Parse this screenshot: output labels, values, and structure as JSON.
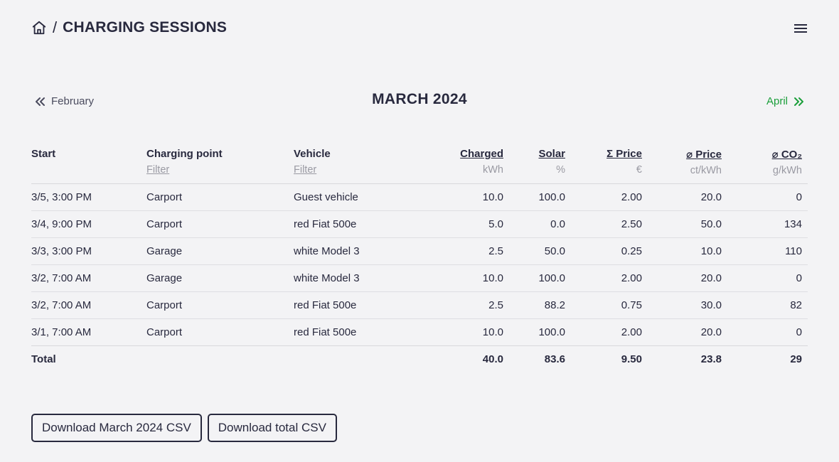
{
  "header": {
    "separator": "/",
    "title": "CHARGING SESSIONS"
  },
  "month_nav": {
    "prev_label": "February",
    "current_label": "MARCH 2024",
    "next_label": "April"
  },
  "table": {
    "headers": {
      "start": "Start",
      "charging_point": "Charging point",
      "charging_point_filter": "Filter",
      "vehicle": "Vehicle",
      "vehicle_filter": "Filter",
      "charged": "Charged",
      "charged_unit": "kWh",
      "solar": "Solar",
      "solar_unit": "%",
      "total_price": "Σ Price",
      "total_price_unit": "€",
      "avg_price": "⌀ Price",
      "avg_price_unit": "ct/kWh",
      "avg_co2": "⌀ CO₂",
      "avg_co2_unit": "g/kWh"
    },
    "rows": [
      {
        "start": "3/5, 3:00 PM",
        "charging_point": "Carport",
        "vehicle": "Guest vehicle",
        "charged": "10.0",
        "solar": "100.0",
        "total_price": "2.00",
        "avg_price": "20.0",
        "avg_co2": "0"
      },
      {
        "start": "3/4, 9:00 PM",
        "charging_point": "Carport",
        "vehicle": "red Fiat 500e",
        "charged": "5.0",
        "solar": "0.0",
        "total_price": "2.50",
        "avg_price": "50.0",
        "avg_co2": "134"
      },
      {
        "start": "3/3, 3:00 PM",
        "charging_point": "Garage",
        "vehicle": "white Model 3",
        "charged": "2.5",
        "solar": "50.0",
        "total_price": "0.25",
        "avg_price": "10.0",
        "avg_co2": "110"
      },
      {
        "start": "3/2, 7:00 AM",
        "charging_point": "Garage",
        "vehicle": "white Model 3",
        "charged": "10.0",
        "solar": "100.0",
        "total_price": "2.00",
        "avg_price": "20.0",
        "avg_co2": "0"
      },
      {
        "start": "3/2, 7:00 AM",
        "charging_point": "Carport",
        "vehicle": "red Fiat 500e",
        "charged": "2.5",
        "solar": "88.2",
        "total_price": "0.75",
        "avg_price": "30.0",
        "avg_co2": "82"
      },
      {
        "start": "3/1, 7:00 AM",
        "charging_point": "Carport",
        "vehicle": "red Fiat 500e",
        "charged": "10.0",
        "solar": "100.0",
        "total_price": "2.00",
        "avg_price": "20.0",
        "avg_co2": "0"
      }
    ],
    "total": {
      "label": "Total",
      "charged": "40.0",
      "solar": "83.6",
      "total_price": "9.50",
      "avg_price": "23.8",
      "avg_co2": "29"
    }
  },
  "buttons": {
    "download_month": "Download March 2024 CSV",
    "download_total": "Download total CSV"
  },
  "colors": {
    "text": "#28293e",
    "muted": "#9a9aa3",
    "accent_green": "#1a9e3a",
    "background": "#f3f3f5"
  },
  "icons": {
    "home": "home-icon",
    "menu": "hamburger-menu-icon",
    "prev": "double-chevron-left-icon",
    "next": "double-chevron-right-icon"
  }
}
